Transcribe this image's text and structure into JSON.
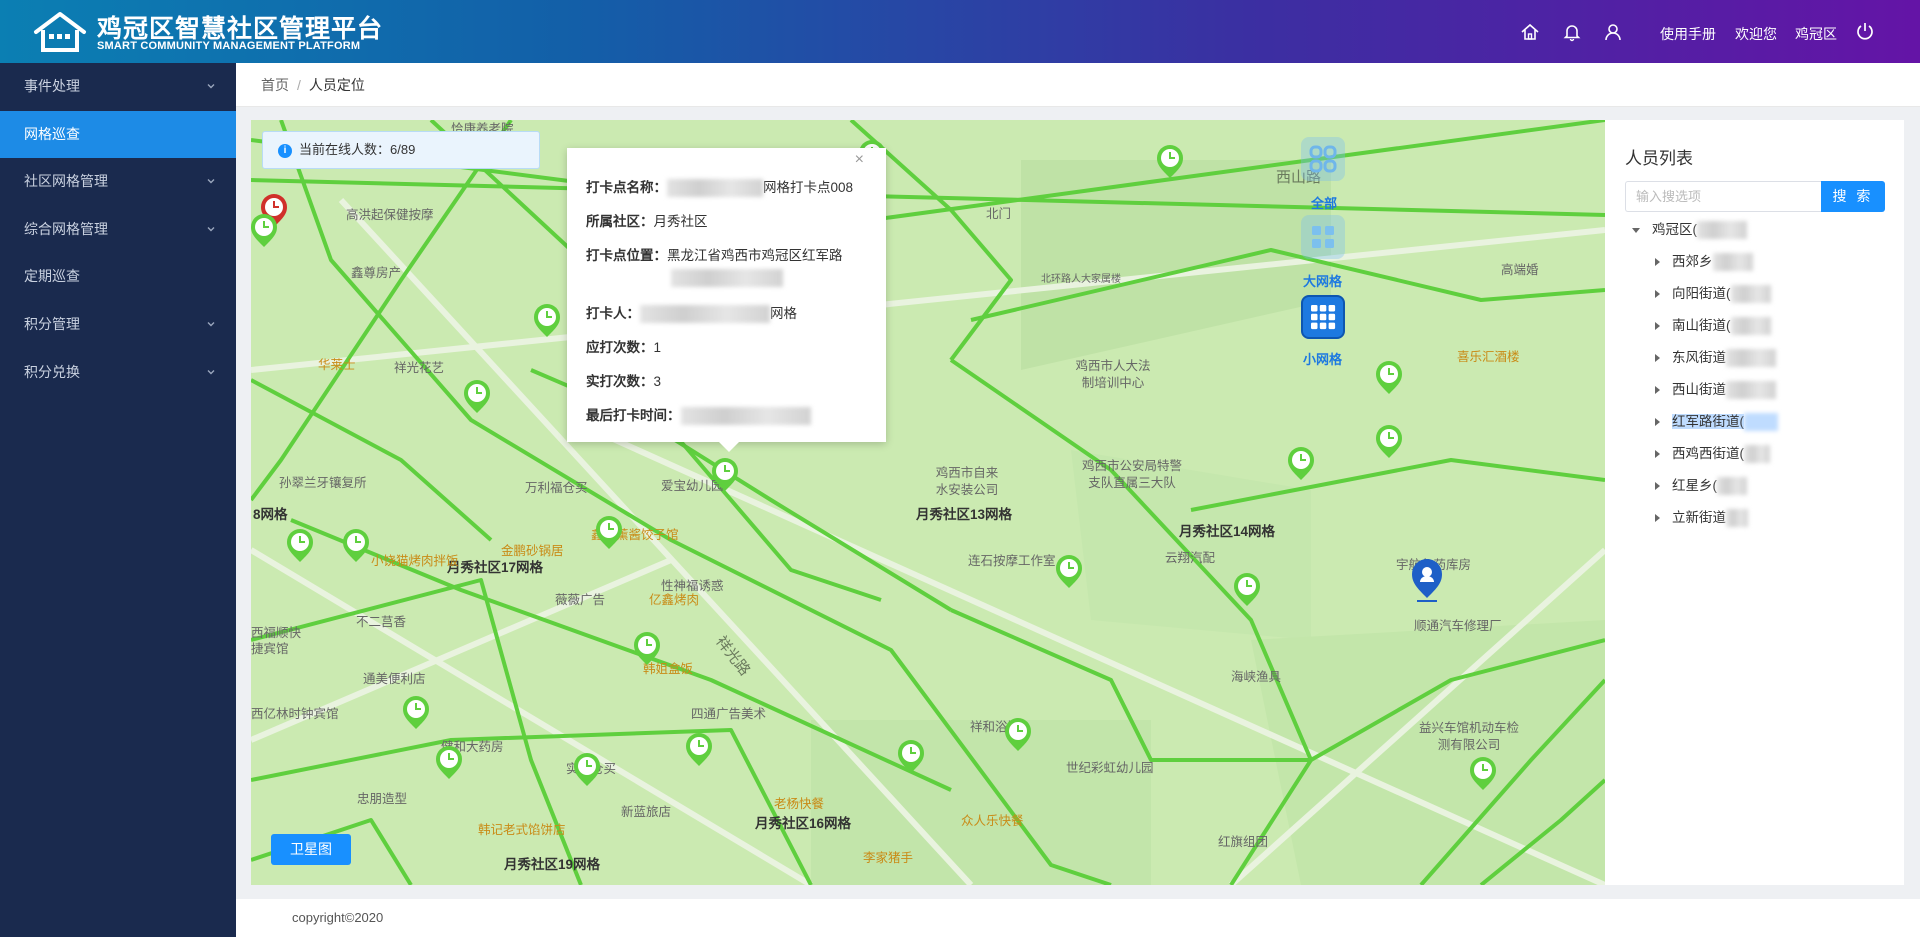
{
  "header": {
    "title": "鸡冠区智慧社区管理平台",
    "subtitle": "SMART COMMUNITY MANAGEMENT PLATFORM",
    "manual_label": "使用手册",
    "welcome_label": "欢迎您",
    "user_label": "鸡冠区"
  },
  "sidebar": {
    "items": [
      {
        "label": "事件处理",
        "has_children": true,
        "active": false
      },
      {
        "label": "网格巡查",
        "has_children": false,
        "active": true
      },
      {
        "label": "社区网格管理",
        "has_children": true,
        "active": false
      },
      {
        "label": "综合网格管理",
        "has_children": true,
        "active": false
      },
      {
        "label": "定期巡查",
        "has_children": false,
        "active": false
      },
      {
        "label": "积分管理",
        "has_children": true,
        "active": false
      },
      {
        "label": "积分兑换",
        "has_children": true,
        "active": false
      }
    ]
  },
  "breadcrumb": {
    "home": "首页",
    "separator": "/",
    "current": "人员定位"
  },
  "online": {
    "label": "当前在线人数：",
    "value": "6/89"
  },
  "popup": {
    "name_label": "打卡点名称：",
    "name_value": "网格打卡点008",
    "community_label": "所属社区：",
    "community_value": "月秀社区",
    "location_label": "打卡点位置：",
    "location_value": "黑龙江省鸡西市鸡冠区红军路",
    "person_label": "打卡人：",
    "person_value": "网格",
    "should_label": "应打次数：",
    "should_value": "1",
    "actual_label": "实打次数：",
    "actual_value": "3",
    "last_label": "最后打卡时间：",
    "close_glyph": "×"
  },
  "map": {
    "layers": [
      {
        "label": "全部",
        "icon": "grid-four-icon"
      },
      {
        "label": "大网格",
        "icon": "grid-large-icon"
      },
      {
        "label": "小网格",
        "icon": "grid-small-icon"
      }
    ],
    "satellite_label": "卫星图",
    "grid_labels": [
      "月秀社区13网格",
      "月秀社区14网格",
      "月秀社区17网格",
      "月秀社区16网格",
      "月秀社区19网格",
      "8网格"
    ],
    "roads": [
      "西山路",
      "祥光路"
    ],
    "pois": [
      {
        "name": "恰康养老院",
        "kind": "gray"
      },
      {
        "name": "高洪起保健按摩",
        "kind": "gray"
      },
      {
        "name": "鑫尊房产",
        "kind": "gray"
      },
      {
        "name": "华莱士",
        "kind": "orange"
      },
      {
        "name": "祥光花艺",
        "kind": "gray"
      },
      {
        "name": "孙翠兰牙镶复所",
        "kind": "gray"
      },
      {
        "name": "万利福仓买",
        "kind": "gray"
      },
      {
        "name": "爱宝幼儿园",
        "kind": "gray"
      },
      {
        "name": "金鹏砂锅居",
        "kind": "orange"
      },
      {
        "name": "小饶猫烤肉拌饭",
        "kind": "orange"
      },
      {
        "name": "鑫亭薰酱饺子馆",
        "kind": "orange"
      },
      {
        "name": "性神福诱惑",
        "kind": "gray"
      },
      {
        "name": "薇薇广告",
        "kind": "gray"
      },
      {
        "name": "亿鑫烤肉",
        "kind": "orange"
      },
      {
        "name": "不二莒香",
        "kind": "gray"
      },
      {
        "name": "西福顺快捷宾馆",
        "kind": "gray"
      },
      {
        "name": "通美便利店",
        "kind": "gray"
      },
      {
        "name": "韩姐盒饭",
        "kind": "orange"
      },
      {
        "name": "四通广告美术",
        "kind": "gray"
      },
      {
        "name": "西亿林时钟宾馆",
        "kind": "gray"
      },
      {
        "name": "健和大药房",
        "kind": "gray"
      },
      {
        "name": "实惠仓买",
        "kind": "gray"
      },
      {
        "name": "忠朋造型",
        "kind": "gray"
      },
      {
        "name": "新蓝旅店",
        "kind": "gray"
      },
      {
        "name": "老杨快餐",
        "kind": "orange"
      },
      {
        "name": "韩记老式馅饼店",
        "kind": "orange"
      },
      {
        "name": "李家猪手",
        "kind": "orange"
      },
      {
        "name": "众人乐快餐",
        "kind": "orange"
      },
      {
        "name": "世纪彩虹幼儿园",
        "kind": "gray"
      },
      {
        "name": "祥和浴池",
        "kind": "gray"
      },
      {
        "name": "连石按摩工作室",
        "kind": "gray"
      },
      {
        "name": "鸡西市自来水安装公司",
        "kind": "gray"
      },
      {
        "name": "鸡西市公安局特警支队直属三大队",
        "kind": "gray"
      },
      {
        "name": "鸡西市人大法制培训中心",
        "kind": "gray"
      },
      {
        "name": "北环路人大家属楼",
        "kind": "gray"
      },
      {
        "name": "北门",
        "kind": "gray"
      },
      {
        "name": "云翔汽配",
        "kind": "gray"
      },
      {
        "name": "海峡渔具",
        "kind": "gray"
      },
      {
        "name": "宇航鲁药库房",
        "kind": "gray"
      },
      {
        "name": "顺通汽车修理厂",
        "kind": "gray"
      },
      {
        "name": "益兴车馆机动车检测有限公司",
        "kind": "gray"
      },
      {
        "name": "喜乐汇酒楼",
        "kind": "orange"
      },
      {
        "name": "高端婚",
        "kind": "gray"
      },
      {
        "name": "红旗组团",
        "kind": "gray"
      }
    ]
  },
  "panel": {
    "title": "人员列表",
    "search_placeholder": "输入搜选项",
    "search_button": "搜 索",
    "tree": {
      "root": "鸡冠区(",
      "children": [
        "西郊乡",
        "向阳街道(",
        "南山街道(",
        "东风街道",
        "西山街道",
        "红军路街道(",
        "西鸡西街道(",
        "红星乡(",
        "立新街道"
      ]
    }
  },
  "footer": {
    "copyright": "copyright©2020"
  },
  "colors": {
    "header_start": "#0b7fb3",
    "header_end": "#6414a6",
    "sidebar": "#1a2a4e",
    "accent": "#1890ff",
    "grid_line": "#5fcf3e",
    "map_bg": "#cbeab1"
  }
}
